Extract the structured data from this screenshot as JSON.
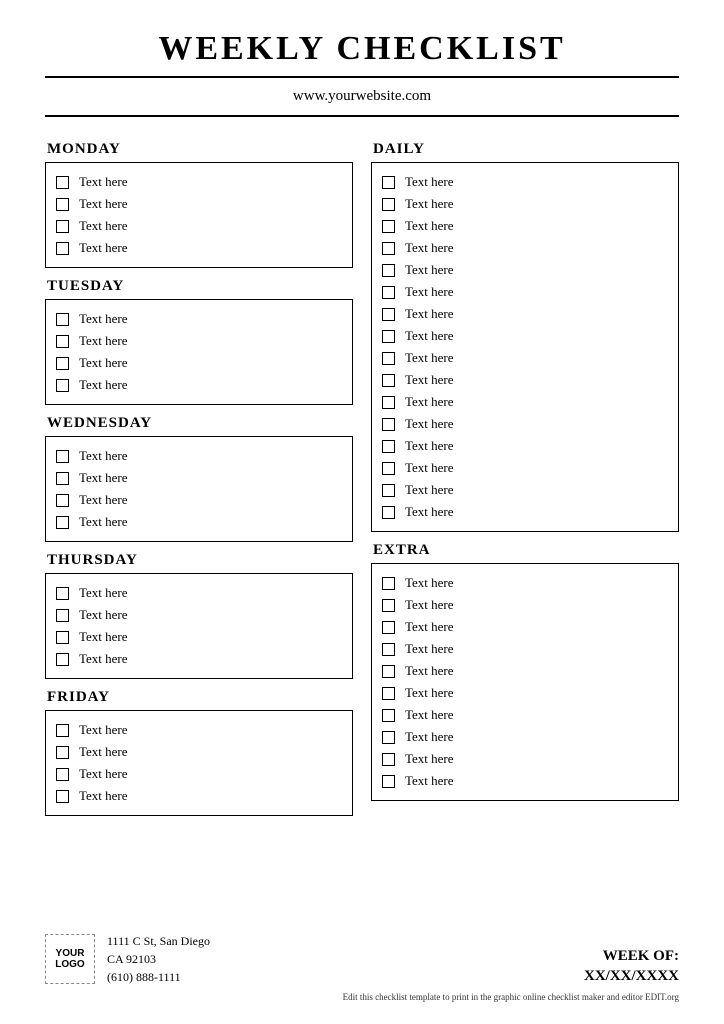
{
  "header": {
    "title": "WEEKLY CHECKLIST",
    "subtitle": "www.yourwebsite.com"
  },
  "left": [
    {
      "title": "MONDAY",
      "items": [
        "Text here",
        "Text here",
        "Text here",
        "Text here"
      ]
    },
    {
      "title": "TUESDAY",
      "items": [
        "Text here",
        "Text here",
        "Text here",
        "Text here"
      ]
    },
    {
      "title": "WEDNESDAY",
      "items": [
        "Text here",
        "Text here",
        "Text here",
        "Text here"
      ]
    },
    {
      "title": "THURSDAY",
      "items": [
        "Text here",
        "Text here",
        "Text here",
        "Text here"
      ]
    },
    {
      "title": "FRIDAY",
      "items": [
        "Text here",
        "Text here",
        "Text here",
        "Text here"
      ]
    }
  ],
  "right": [
    {
      "title": "DAILY",
      "items": [
        "Text here",
        "Text here",
        "Text here",
        "Text here",
        "Text here",
        "Text here",
        "Text here",
        "Text here",
        "Text here",
        "Text here",
        "Text here",
        "Text here",
        "Text here",
        "Text here",
        "Text here",
        "Text here"
      ]
    },
    {
      "title": "EXTRA",
      "items": [
        "Text here",
        "Text here",
        "Text here",
        "Text here",
        "Text here",
        "Text here",
        "Text here",
        "Text here",
        "Text here",
        "Text here"
      ]
    }
  ],
  "footer": {
    "logo": "YOUR LOGO",
    "address1": "1111 C St, San Diego",
    "address2": "CA 92103",
    "phone": "(610) 888-1111",
    "week_label": "WEEK OF:",
    "week_value": "XX/XX/XXXX",
    "footnote": "Edit this checklist template to print in the graphic online checklist maker and editor EDIT.org"
  }
}
